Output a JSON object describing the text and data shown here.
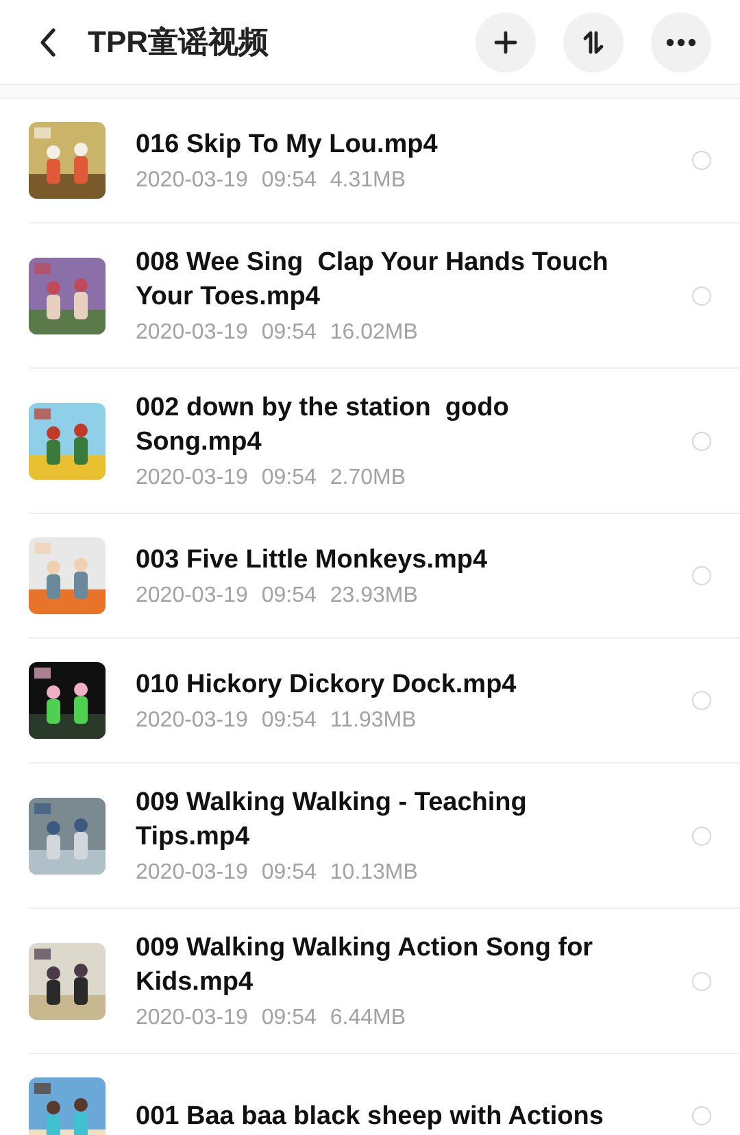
{
  "header": {
    "title": "TPR童谣视频"
  },
  "files": [
    {
      "name": "016 Skip To My Lou.mp4",
      "date": "2020-03-19",
      "time": "09:54",
      "size": "4.31MB",
      "selected": false
    },
    {
      "name": "008 Wee Sing  Clap Your Hands Touch Your Toes.mp4",
      "date": "2020-03-19",
      "time": "09:54",
      "size": "16.02MB",
      "selected": false
    },
    {
      "name": "002 down by the station  godo Song.mp4",
      "date": "2020-03-19",
      "time": "09:54",
      "size": "2.70MB",
      "selected": false
    },
    {
      "name": "003 Five Little Monkeys.mp4",
      "date": "2020-03-19",
      "time": "09:54",
      "size": "23.93MB",
      "selected": false
    },
    {
      "name": "010 Hickory Dickory Dock.mp4",
      "date": "2020-03-19",
      "time": "09:54",
      "size": "11.93MB",
      "selected": false
    },
    {
      "name": "009 Walking Walking - Teaching Tips.mp4",
      "date": "2020-03-19",
      "time": "09:54",
      "size": "10.13MB",
      "selected": false
    },
    {
      "name": "009 Walking Walking Action Song for Kids.mp4",
      "date": "2020-03-19",
      "time": "09:54",
      "size": "6.44MB",
      "selected": false
    },
    {
      "name": "001 Baa baa black sheep with Actions",
      "selected": false
    }
  ]
}
